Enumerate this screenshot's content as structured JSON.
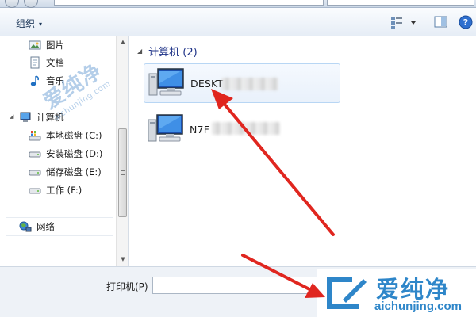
{
  "toolbar": {
    "organize_label": "组织",
    "caret": "▾"
  },
  "nav": {
    "pictures": "图片",
    "documents": "文档",
    "music": "音乐",
    "computer": "计算机",
    "drive_c": "本地磁盘 (C:)",
    "drive_d": "安装磁盘 (D:)",
    "drive_e": "储存磁盘 (E:)",
    "drive_f": "工作 (F:)",
    "network": "网络"
  },
  "content": {
    "group_title": "计算机 (2)",
    "computers": [
      {
        "label": "DESKT",
        "selected": true
      },
      {
        "label": "N7F",
        "selected": false
      }
    ]
  },
  "bottom": {
    "printer_label": "打印机(P)",
    "printer_underline": "P",
    "printer_value": ""
  },
  "watermark": {
    "diag_big": "爱纯净",
    "diag_small": "aichunjing.com",
    "logo_cn": "爱纯净",
    "logo_en": "aichunjing.com"
  },
  "colors": {
    "accent": "#1e3287",
    "selection_border": "#b8d6f4",
    "annotation_red": "#e0261f",
    "watermark_blue": "#2e86c9"
  },
  "icons": {
    "pictures": "pictures-library-icon",
    "documents": "documents-library-icon",
    "music": "music-note-icon",
    "computer": "computer-icon",
    "drive_c": "windows-drive-icon",
    "drive": "hard-drive-icon",
    "network": "network-icon"
  }
}
